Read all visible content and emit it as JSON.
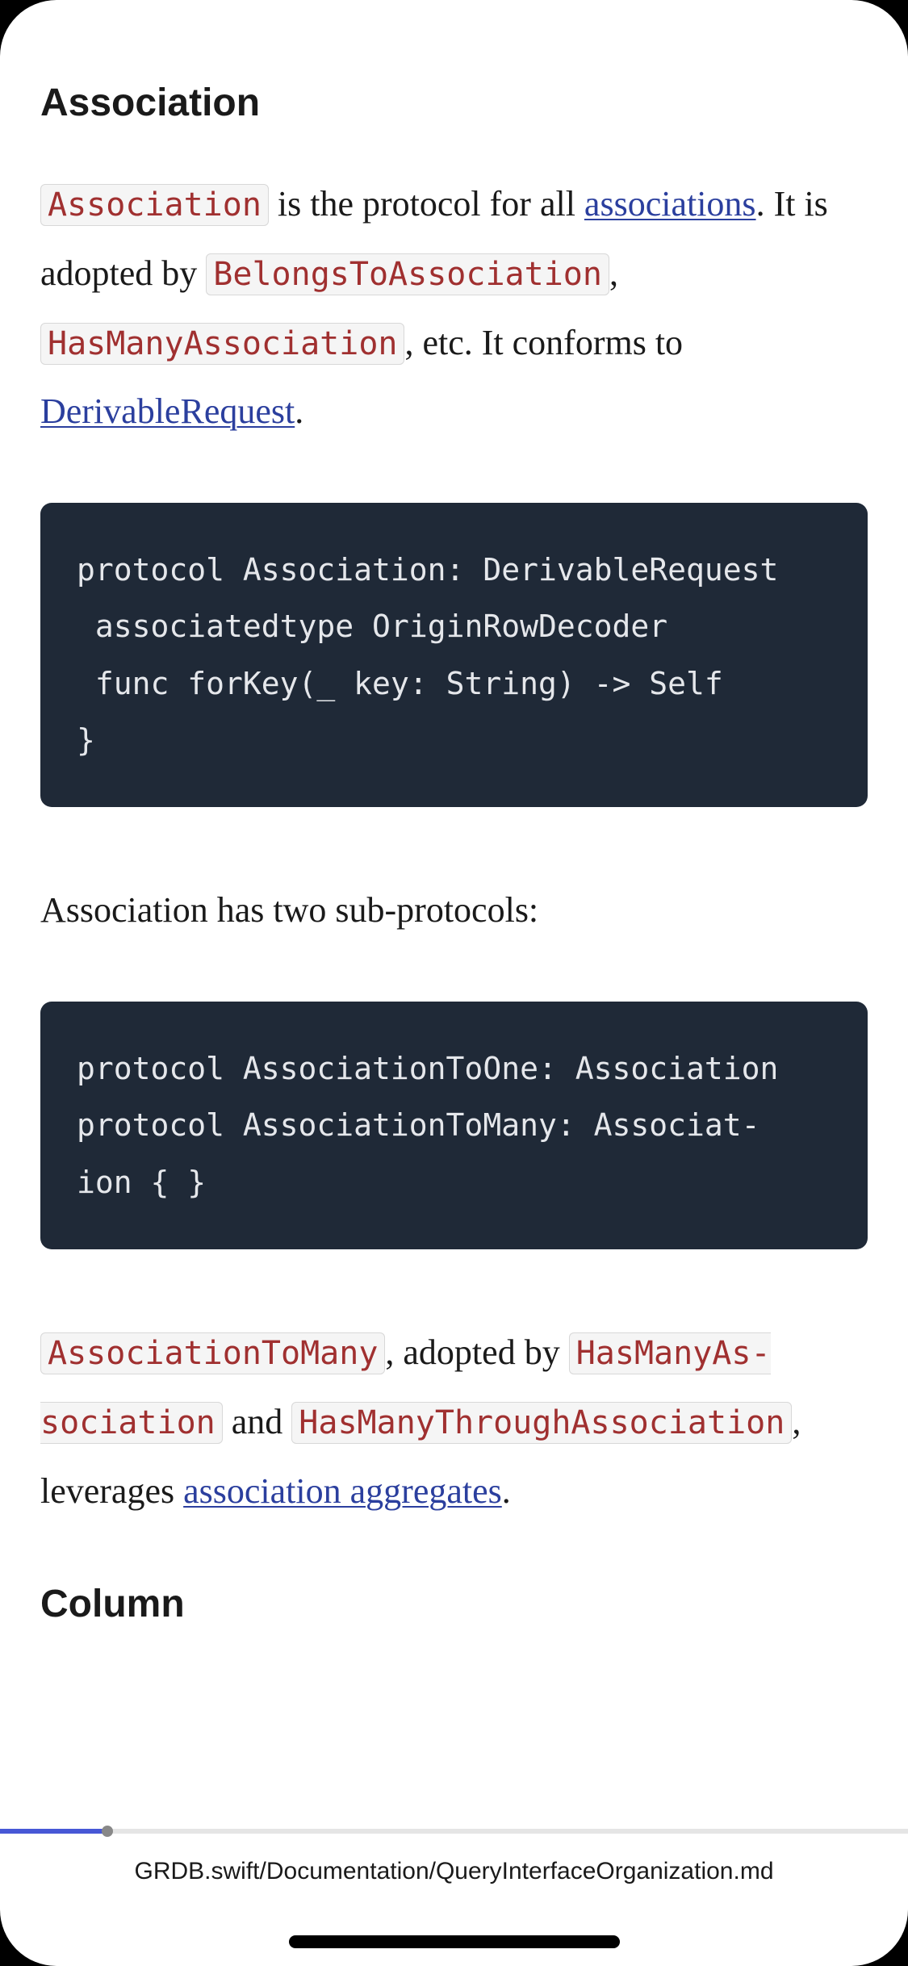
{
  "sections": {
    "association": {
      "heading": "Association",
      "para1": {
        "code1": "Association",
        "text1": " is the protocol for all ",
        "link1": "associa­tions",
        "text2": ". It is adopted by ",
        "code2": "BelongsToAssocia­tion",
        "text3": ", ",
        "code3": "HasManyAssociation",
        "text4": ", etc. It conforms to ",
        "link2": "DerivableRequest",
        "text5": "."
      },
      "codeblock1": "protocol Association: DerivableRequest\n associatedtype OriginRowDecoder\n func forKey(_ key: String) -> Self\n}",
      "para2": "Association has two sub-protocols:",
      "codeblock2": "protocol AssociationToOne: Association\nprotocol AssociationToMany: Associat-\nion { }",
      "para3": {
        "code1": "AssociationToMany",
        "text1": ", adopted by ",
        "code2": "HasManyAs­sociation",
        "text2": " and ",
        "code3": "HasManyThroughAssociation",
        "text3": ", leverages ",
        "link1": "association aggregates",
        "text4": "."
      }
    },
    "column": {
      "heading": "Column"
    }
  },
  "footer": {
    "path": "GRDB.swift/Documentation/QueryInterfaceOrganization.md"
  }
}
